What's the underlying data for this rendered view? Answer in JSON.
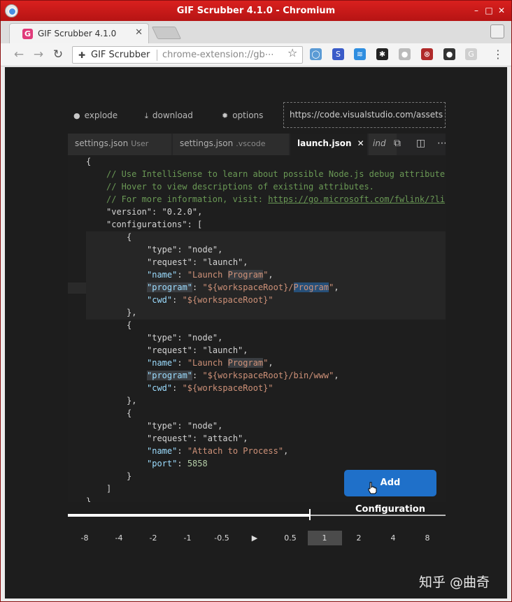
{
  "window": {
    "title": "GIF Scrubber 4.1.0 - Chromium",
    "controls": [
      "–",
      "□",
      "✕"
    ]
  },
  "browser": {
    "tab_title": "GIF Scrubber 4.1.0",
    "tab_favicon": "G",
    "tab_close": "✕",
    "omnibox_site": "GIF Scrubber",
    "omnibox_url": "chrome-extension://gb⋯",
    "extensions": [
      {
        "name": "circle-ext-icon",
        "glyph": "◯",
        "color": "#5b9bd5"
      },
      {
        "name": "s-ext-icon",
        "glyph": "S",
        "color": "#3a5bc8"
      },
      {
        "name": "chevrons-ext-icon",
        "glyph": "≋",
        "color": "#2f8ee0"
      },
      {
        "name": "spider-ext-icon",
        "glyph": "✱",
        "color": "#222222"
      },
      {
        "name": "drop-ext-icon",
        "glyph": "●",
        "color": "#bbbbbb"
      },
      {
        "name": "globe-ext-icon",
        "glyph": "⊗",
        "color": "#b02a2a"
      },
      {
        "name": "dots-ext-icon",
        "glyph": "●",
        "color": "#333333"
      },
      {
        "name": "g-ext-icon",
        "glyph": "G",
        "color": "#cfcfcf"
      }
    ]
  },
  "scrubber": {
    "actions": {
      "explode": "explode",
      "download": "download",
      "options": "options"
    },
    "url_value": "https://code.visualstudio.com/assets",
    "progress": 0.64,
    "speeds": [
      "-8",
      "-4",
      "-2",
      "-1",
      "-0.5",
      "▶",
      "0.5",
      "1",
      "2",
      "4",
      "8"
    ],
    "active_speed": "1"
  },
  "editor": {
    "tabs": [
      {
        "label": "settings.json",
        "dim": "User",
        "active": false
      },
      {
        "label": "settings.json",
        "dim": ".vscode",
        "active": false
      },
      {
        "label": "launch.json",
        "dim": "",
        "active": true,
        "close": "✕"
      },
      {
        "label": "ind",
        "dim": "",
        "active": false
      }
    ],
    "button": "Add Configuration",
    "code": {
      "l1": "{",
      "c1": "// Use IntelliSense to learn about possible Node.js debug attribute",
      "c2": "// Hover to view descriptions of existing attributes.",
      "c3a": "// For more information, visit: ",
      "c3b": "https://go.microsoft.com/fwlink/?li",
      "version_key": "\"version\"",
      "version_val": "\"0.2.0\"",
      "configs_key": "\"configurations\"",
      "type": "\"type\"",
      "request": "\"request\"",
      "name": "\"name\"",
      "program": "\"program\"",
      "cwd": "\"cwd\"",
      "port": "\"port\"",
      "node": "\"node\"",
      "launch": "\"launch\"",
      "attach": "\"attach\"",
      "launch_program_a": "\"Launch ",
      "launch_program_b": "Program",
      "launch_program_c": "\"",
      "prog1_a": "\"${workspaceRoot}/",
      "prog1_b": "Program",
      "prog1_c": "\"",
      "prog2_a": "\"${workspaceRoot}/bin/www\"",
      "ws_root": "\"${workspaceRoot}\"",
      "attach_name": "\"Attach to Process\"",
      "port_val": "5858"
    }
  },
  "watermark": "知乎 @曲奇"
}
